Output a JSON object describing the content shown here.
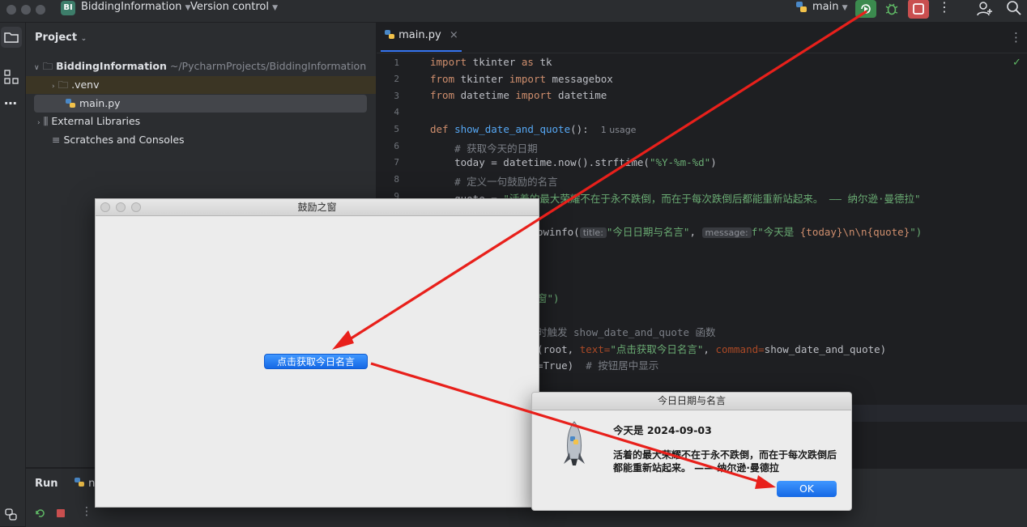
{
  "titlebar": {
    "project_badge": "BI",
    "project_name": "BiddingInformation",
    "version_control": "Version control",
    "branch": "main"
  },
  "project_panel": {
    "header": "Project",
    "tree": {
      "root_name": "BiddingInformation",
      "root_path": "~/PycharmProjects/BiddingInformation",
      "venv": ".venv",
      "main_file": "main.py",
      "external_libraries": "External Libraries",
      "scratches": "Scratches and Consoles"
    }
  },
  "editor": {
    "tab_label": "main.py",
    "line_numbers": [
      "1",
      "2",
      "3",
      "4",
      "5",
      "6",
      "7",
      "8",
      "9"
    ],
    "usage_hint": "1 usage",
    "hint_title": "title:",
    "hint_message": "message:",
    "lines": {
      "l1": [
        "import",
        " tkinter ",
        "as",
        " tk"
      ],
      "l2": [
        "from",
        " tkinter ",
        "import",
        " messagebox"
      ],
      "l3": [
        "from",
        " datetime ",
        "import",
        " datetime"
      ],
      "l5": [
        "def",
        " ",
        "show_date_and_quote",
        "():"
      ],
      "l6": "    # 获取今天的日期",
      "l7a": "    today = datetime.now().strftime(",
      "l7b": "\"%Y-%m-%d\"",
      "l7c": ")",
      "l8": "    # 定义一句鼓励的名言",
      "l9a": "    quote = ",
      "l9b": "\"活着的最大荣耀不在于永不跌倒，而在于每次跌倒后都能重新站起来。 —— 纳尔逊·曼德拉\"",
      "l10a": "owinfo(",
      "l10b": "\"今日日期与名言\"",
      "l10c": ", ",
      "l10d": "f\"今天是 ",
      "l10e": "{today}\\n\\n{quote}",
      "l10f": "\")",
      "l13": "窗\")",
      "l15a": "时触发 show_date_and_quote 函数",
      "l16a": "(root, ",
      "l16b": "text=",
      "l16c": "\"点击获取今日名言\"",
      "l16d": ", ",
      "l16e": "command=",
      "l16f": "show_date_and_quote)",
      "l17a": "=True)  ",
      "l17b": "# 按钮居中显示"
    }
  },
  "run_panel": {
    "title": "Run",
    "tab_fragment": "n"
  },
  "tk_window": {
    "title": "鼓励之窗",
    "button_label": "点击获取今日名言"
  },
  "messagebox": {
    "title": "今日日期与名言",
    "heading": "今天是 2024-09-03",
    "body": "活着的最大荣耀不在于永不跌倒，而在于每次跌倒后都能重新站起来。 —— 纳尔逊·曼德拉",
    "ok_label": "OK"
  },
  "colors": {
    "accent_blue": "#3574f0",
    "run_green": "#3b8a4e",
    "stop_red": "#c94f4f",
    "annotation_red": "#e8201b"
  }
}
